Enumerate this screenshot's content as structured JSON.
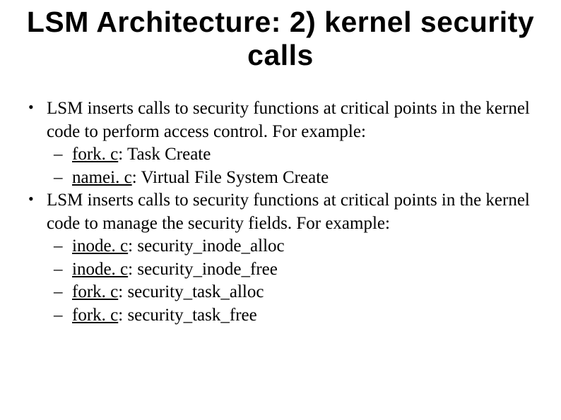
{
  "title": "LSM Architecture: 2) kernel security calls",
  "bullets": [
    {
      "text": "LSM inserts calls to security functions at critical points in the kernel code to perform access control. For example:",
      "subitems": [
        {
          "file": "fork. c",
          "desc": "Task Create"
        },
        {
          "file": "namei. c",
          "desc": "Virtual File System Create"
        }
      ]
    },
    {
      "text": "LSM inserts calls to security functions at critical points in the kernel code to manage the security fields. For example:",
      "subitems": [
        {
          "file": "inode. c",
          "desc": "security_inode_alloc"
        },
        {
          "file": "inode. c",
          "desc": "security_inode_free"
        },
        {
          "file": "fork. c",
          "desc": "security_task_alloc"
        },
        {
          "file": "fork. c",
          "desc": "security_task_free"
        }
      ]
    }
  ]
}
